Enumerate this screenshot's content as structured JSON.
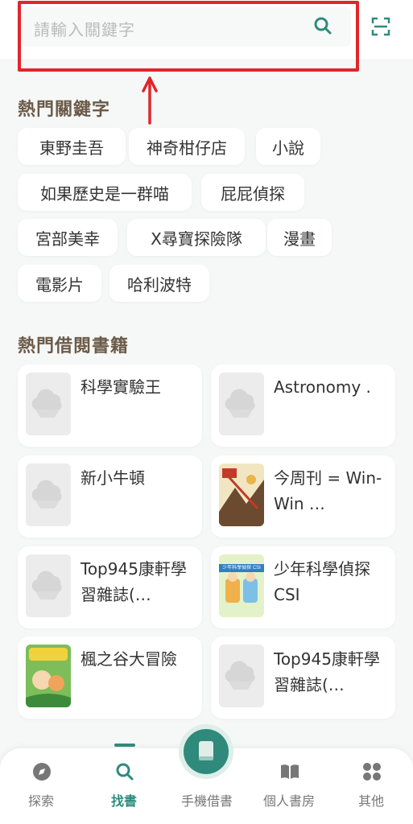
{
  "search": {
    "placeholder": "請輸入關鍵字"
  },
  "popular_keywords": {
    "title": "熱門關鍵字",
    "items": [
      "東野圭吾",
      "神奇柑仔店",
      "小說",
      "如果歷史是一群喵",
      "屁屁偵探",
      "宮部美幸",
      "X尋寶探險隊",
      "漫畫",
      "電影片",
      "哈利波特"
    ]
  },
  "popular_books": {
    "title": "熱門借閱書籍",
    "items": [
      {
        "title": "科學實驗王",
        "cover": "placeholder"
      },
      {
        "title": "Astronomy .",
        "cover": "placeholder"
      },
      {
        "title": "新小牛頓",
        "cover": "placeholder"
      },
      {
        "title": "今周刊 = Win-Win …",
        "cover": "illustrated"
      },
      {
        "title": "Top945康軒學習雜誌(…",
        "cover": "placeholder"
      },
      {
        "title": "少年科學偵探CSI",
        "cover": "illustrated",
        "cover_text": "少年科學偵探 CSI"
      },
      {
        "title": "楓之谷大冒險",
        "cover": "illustrated"
      },
      {
        "title": "Top945康軒學習雜誌(…",
        "cover": "placeholder"
      }
    ]
  },
  "bottom_nav": {
    "items": [
      {
        "label": "探索",
        "icon": "compass-icon"
      },
      {
        "label": "找書",
        "icon": "search-icon",
        "active": true
      },
      {
        "label": "手機借書",
        "icon": "book-icon"
      },
      {
        "label": "個人書房",
        "icon": "open-book-icon"
      },
      {
        "label": "其他",
        "icon": "grid-icon"
      }
    ]
  },
  "colors": {
    "accent": "#2f8a7c",
    "section_title": "#6b5a48",
    "annotation": "#e0262b"
  }
}
